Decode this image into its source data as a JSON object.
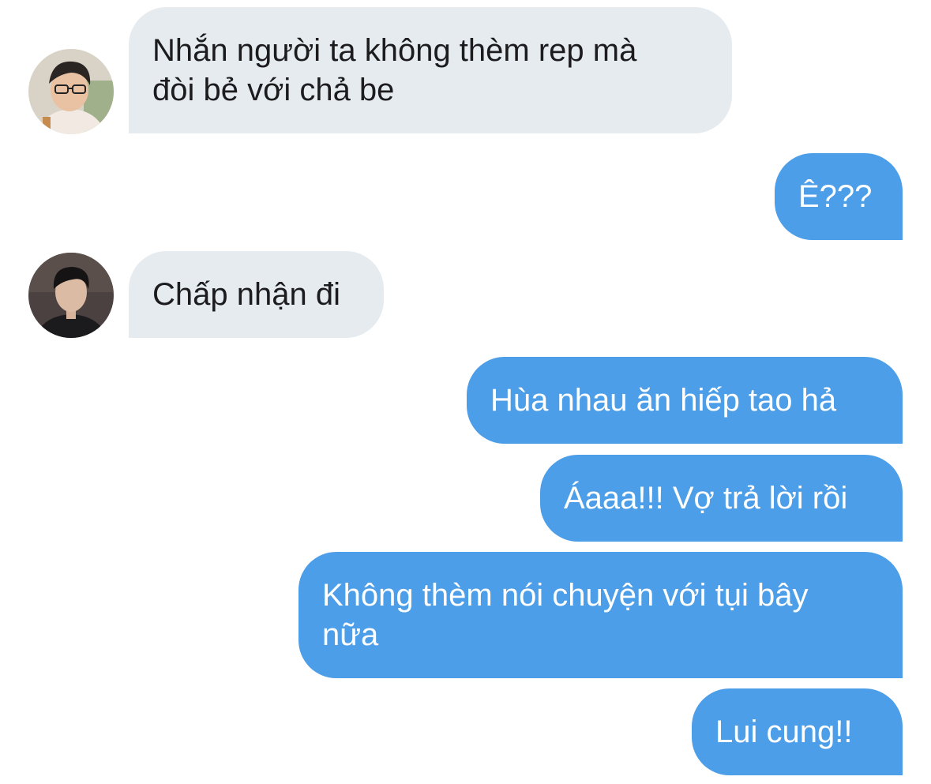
{
  "messages": [
    {
      "sender": "other",
      "avatar": "avatar-1",
      "text": "Nhắn người ta không thèm rep mà\nđòi bẻ với chả be"
    },
    {
      "sender": "me",
      "text": "Ê???"
    },
    {
      "sender": "other",
      "avatar": "avatar-2",
      "text": "Chấp nhận đi"
    },
    {
      "sender": "me",
      "text": "Hùa nhau ăn hiếp tao hả"
    },
    {
      "sender": "me",
      "text": "Áaaa!!! Vợ trả lời rồi"
    },
    {
      "sender": "me",
      "text": "Không thèm nói chuyện với tụi bây\nnữa"
    },
    {
      "sender": "me",
      "text": "Lui cung!!"
    }
  ],
  "colors": {
    "incoming_bubble": "#e6ebef",
    "outgoing_bubble": "#4d9ee8",
    "incoming_text": "#1c1c1e",
    "outgoing_text": "#ffffff"
  }
}
